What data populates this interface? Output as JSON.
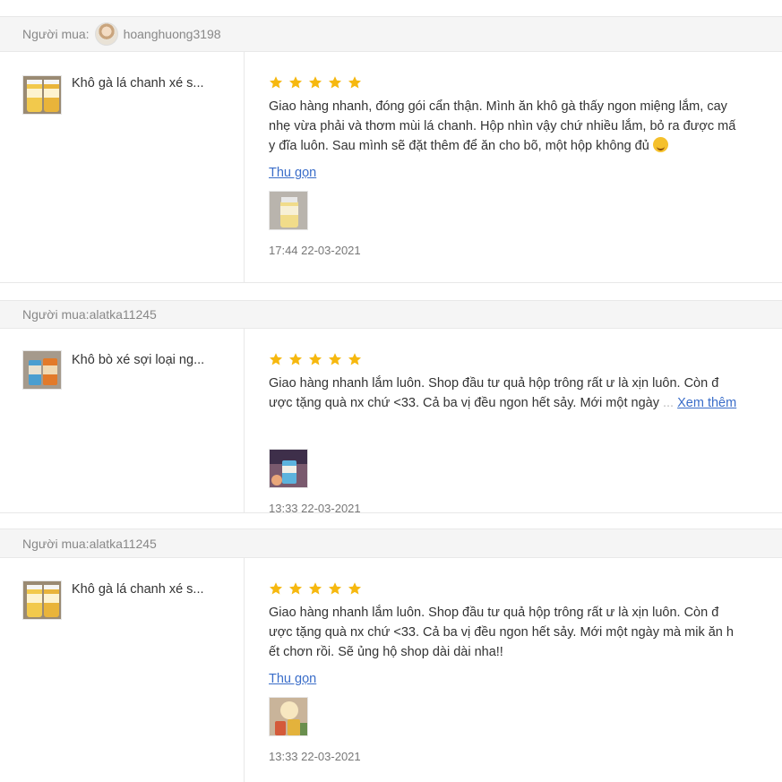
{
  "reviews": [
    {
      "buyer_label": "Người mua:",
      "buyer_name": "hoanghuong3198",
      "product_name": "Khô gà lá chanh xé s...",
      "rating": 5,
      "comment_lines": [
        "Giao hàng nhanh, đóng gói cẩn thận. Mình ăn khô gà thấy ngon miệng lắm, cay",
        "nhẹ vừa phải và thơm mùi lá chanh. Hộp nhìn vậy chứ nhiều lắm, bỏ ra được mấ",
        "y đĩa luôn. Sau mình sẽ đặt thêm để ăn cho bõ, một hộp không đủ"
      ],
      "toggle_label": "Thu gọn",
      "timestamp": "17:44 22-03-2021"
    },
    {
      "buyer_label": "Người mua:",
      "buyer_name": "alatka11245",
      "product_name": "Khô bò xé sợi loại ng...",
      "rating": 5,
      "comment_lines": [
        "Giao hàng nhanh lắm luôn. Shop đầu tư quả hộp trông rất ư là xịn luôn. Còn đ",
        "ược tặng quà nx chứ <33. Cả ba vị đều ngon hết sảy. Mới một ngày"
      ],
      "truncation": "...",
      "toggle_label": "Xem thêm",
      "timestamp": "13:33 22-03-2021"
    },
    {
      "buyer_label": "Người mua:",
      "buyer_name": "alatka11245",
      "product_name": "Khô gà lá chanh xé s...",
      "rating": 5,
      "comment_lines": [
        "Giao hàng nhanh lắm luôn. Shop đầu tư quả hộp trông rất ư là xịn luôn. Còn đ",
        "ược tặng quà nx chứ <33. Cả ba vị đều ngon hết sảy. Mới một ngày mà mik ăn h",
        "ết chơn rồi. Sẽ ủng hộ shop dài dài nha!!"
      ],
      "toggle_label": "Thu gọn",
      "timestamp": "13:33 22-03-2021"
    }
  ],
  "colors": {
    "star": "#f6b80f",
    "link": "#3a6dc9",
    "header_bg": "#f5f5f5"
  },
  "icons": {
    "star": "star-icon",
    "emoji": "yum-face-emoji-icon"
  }
}
